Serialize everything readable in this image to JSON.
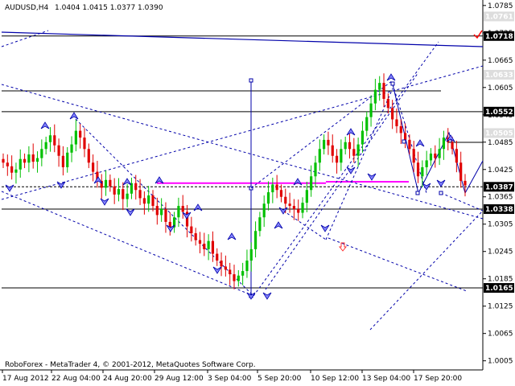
{
  "header": {
    "symbol": "AUDUSD,H4",
    "ohlc": "1.0404 1.0415 1.0377 1.0390"
  },
  "footer": {
    "copyright": "RoboForex - MetaTrader 4, © 2001-2012, MetaQuotes Software Corp."
  },
  "colors": {
    "bull": "#00c000",
    "bear": "#e00000",
    "trend": "#0000aa",
    "level": "#000000",
    "magenta": "#ff00ff",
    "arrow": "#ff3333",
    "check": "#ff0000"
  },
  "chart_data": {
    "type": "candlestick",
    "ylim": [
      0.9985,
      1.079
    ],
    "yticks": [
      "1.0785",
      "1.0725",
      "1.0665",
      "1.0605",
      "1.0545",
      "1.0485",
      "1.0425",
      "1.0365",
      "1.0305",
      "1.0245",
      "1.0185",
      "1.0125",
      "1.0065",
      "1.0005"
    ],
    "ytick_values": [
      1.0785,
      1.0725,
      1.0665,
      1.0605,
      1.0545,
      1.0485,
      1.0425,
      1.0365,
      1.0305,
      1.0245,
      1.0185,
      1.0125,
      1.0065,
      1.0005
    ],
    "price_labels": [
      {
        "text": "1.0718",
        "value": 1.0718
      },
      {
        "text": "1.0552",
        "value": 1.0552
      },
      {
        "text": "1.0387",
        "value": 1.0387
      },
      {
        "text": "1.0338",
        "value": 1.0338
      },
      {
        "text": "1.0165",
        "value": 1.0165
      }
    ],
    "faded_labels": [
      {
        "text": "1.0761",
        "value": 1.0761
      },
      {
        "text": "1.0633",
        "value": 1.0633
      },
      {
        "text": "1.0505",
        "value": 1.0505
      }
    ],
    "xticks": [
      "17 Aug 2012",
      "22 Aug 04:00",
      "24 Aug 20:00",
      "29 Aug 12:00",
      "3 Sep 04:00",
      "5 Sep 20:00",
      "10 Sep 12:00",
      "13 Sep 04:00",
      "17 Sep 20:00"
    ],
    "closes": [
      1.044,
      1.0432,
      1.0418,
      1.0425,
      1.0448,
      1.044,
      1.0458,
      1.0442,
      1.045,
      1.047,
      1.0485,
      1.05,
      1.0478,
      1.0455,
      1.043,
      1.0462,
      1.048,
      1.051,
      1.0495,
      1.047,
      1.044,
      1.042,
      1.04,
      1.0385,
      1.0402,
      1.0388,
      1.037,
      1.0382,
      1.036,
      1.0372,
      1.0395,
      1.038,
      1.0362,
      1.035,
      1.0368,
      1.0345,
      1.0325,
      1.0338,
      1.031,
      1.0298,
      1.032,
      1.0345,
      1.0332,
      1.03,
      1.0285,
      1.027,
      1.0262,
      1.025,
      1.0268,
      1.024,
      1.0225,
      1.0212,
      1.0205,
      1.0195,
      1.018,
      1.0192,
      1.0202,
      1.0225,
      1.025,
      1.029,
      1.032,
      1.035,
      1.0375,
      1.0392,
      1.038,
      1.0365,
      1.035,
      1.0345,
      1.0338,
      1.033,
      1.0352,
      1.038,
      1.041,
      1.044,
      1.047,
      1.049,
      1.0478,
      1.0455,
      1.044,
      1.047,
      1.0485,
      1.047,
      1.0455,
      1.048,
      1.051,
      1.054,
      1.057,
      1.06,
      1.0615,
      1.058,
      1.056,
      1.0535,
      1.052,
      1.0505,
      1.049,
      1.047,
      1.044,
      1.041,
      1.043,
      1.0445,
      1.046,
      1.045,
      1.047,
      1.0495,
      1.0485,
      1.047,
      1.044,
      1.04,
      1.039
    ]
  }
}
